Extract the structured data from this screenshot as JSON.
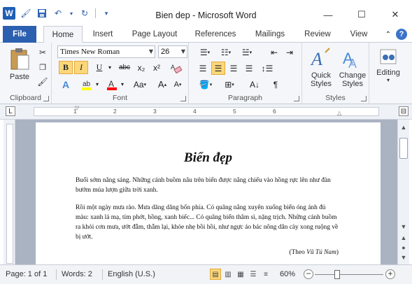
{
  "window": {
    "title": "Bien dep  -  Microsoft Word",
    "minimize": "—",
    "maximize": "☐",
    "close": "✕"
  },
  "qat": {
    "logo": "W",
    "save_icon": "floppy-icon",
    "undo_icon": "undo-icon",
    "redo_icon": "redo-icon"
  },
  "tabs": [
    "File",
    "Home",
    "Insert",
    "Page Layout",
    "References",
    "Mailings",
    "Review",
    "View"
  ],
  "ribbon": {
    "clipboard": {
      "label": "Clipboard",
      "paste": "Paste"
    },
    "font": {
      "label": "Font",
      "name": "Times New Roman",
      "size": "26",
      "bold": "B",
      "italic": "I",
      "underline": "U",
      "strike": "abc",
      "sub": "x₂",
      "sup": "x²",
      "grow": "A",
      "shrink": "A",
      "case": "Aa",
      "highlight_color": "#ffff00",
      "font_color": "#ff0000"
    },
    "paragraph": {
      "label": "Paragraph"
    },
    "styles": {
      "label": "Styles",
      "quick_styles": "Quick Styles",
      "change_styles": "Change Styles"
    },
    "editing": {
      "label": "Editing"
    }
  },
  "ruler": {
    "numbers": [
      "1",
      "2",
      "3",
      "4",
      "5",
      "6"
    ]
  },
  "document": {
    "title": "Biển đẹp",
    "p1": "Buổi sớm nắng sáng. Những cánh buồm nâu trên biển được nắng chiếu vào hồng rực lên như đàn bướm múa lượn giữa trời xanh.",
    "p2": "Rồi một ngày mưa rào. Mưa dăng dăng bốn phía. Có quãng nắng xuyên xuống biển óng ánh đủ màu: xanh lá mạ, tím phớt, hồng, xanh biếc... Có quãng biển thâm sì, nặng trịch. Những cánh buồm ra khỏi cơn mưa, ướt đẫm, thẫm lại, khỏe nhẹ bồi hồi, như ngực áo bác nông dân cày xong ruộng về bị ướt.",
    "source_prefix": "(Theo ",
    "source_author": "Vũ Tú Nam",
    "source_suffix": ")"
  },
  "status": {
    "page": "Page: 1 of 1",
    "words": "Words: 2",
    "language": "English (U.S.)",
    "zoom": "60%",
    "zoom_level": 0.6
  }
}
